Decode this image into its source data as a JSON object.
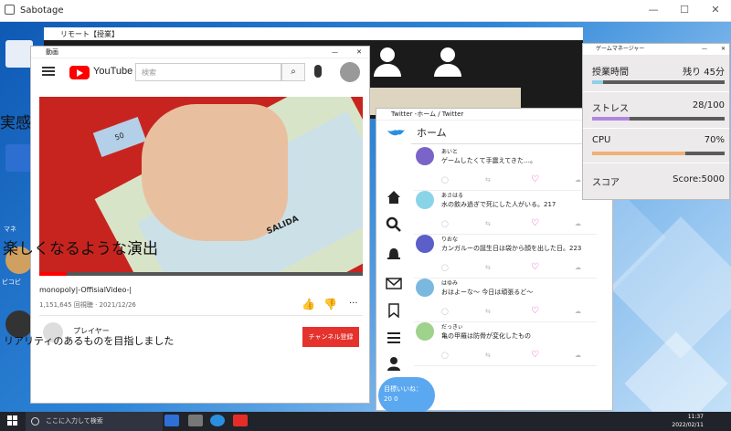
{
  "outer": {
    "title": "Sabotage"
  },
  "remote": {
    "title": "リモート【授業】"
  },
  "desktop_icons": [
    "マネ",
    "ビコビ"
  ],
  "narration": {
    "line1": "実感",
    "line2": "楽しくなるような演出",
    "line3": "リアリティのあるものを目指しました"
  },
  "youtube": {
    "window_title": "動画",
    "brand": "YouTube",
    "search_placeholder": "検索",
    "video_title": "monopoly|-OffisialVideo-|",
    "stats": "1,151,645 回視聴 · 2021/12/26",
    "channel": "プレイヤー",
    "subscribe": "チャンネル登録",
    "board_cards": [
      "50",
      "SALIDA"
    ]
  },
  "twitter": {
    "window_title": "Twitter -ホーム / Twitter",
    "home": "ホーム",
    "badge": "目標いいね：20 0",
    "tweets": [
      {
        "name": "あいと",
        "text": "ゲームしたくて手震えてきた…。",
        "color": "#7a64c8"
      },
      {
        "name": "あさはる",
        "text": "水の飲み過ぎで死にした人がいる。217",
        "color": "#8ad4e8"
      },
      {
        "name": "りおな",
        "text": "カンガルーの誕生日は袋から顔を出した日。223",
        "color": "#5b5fc7"
      },
      {
        "name": "はゆみ",
        "text": "おはよーな～ 今日は頑張るど～",
        "color": "#7ab8e0"
      },
      {
        "name": "だっきぃ",
        "text": "亀の甲羅は防骨が変化したもの",
        "color": "#9fd28a"
      }
    ]
  },
  "game_manager": {
    "title": "ゲームマネージャー",
    "rows": [
      {
        "label": "授業時間",
        "value": "残り 45分",
        "fraction": 0.08,
        "color": "#8fd0e8"
      },
      {
        "label": "ストレス",
        "value": "28/100",
        "fraction": 0.28,
        "color": "#b184e0"
      },
      {
        "label": "CPU",
        "value": "70%",
        "fraction": 0.7,
        "color": "#f0b078"
      },
      {
        "label": "スコア",
        "value": "Score:5000"
      }
    ]
  },
  "taskbar": {
    "search": "ここに入力して検索",
    "time": "11:37",
    "date": "2022/02/11"
  }
}
